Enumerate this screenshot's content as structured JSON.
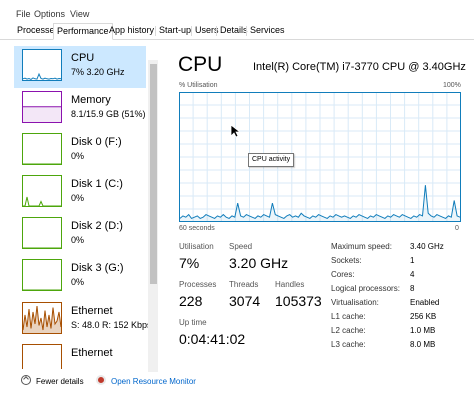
{
  "menu": [
    "File",
    "Options",
    "View"
  ],
  "tabs": [
    "Processes",
    "Performance",
    "App history",
    "Start-up",
    "Users",
    "Details",
    "Services"
  ],
  "active_tab": "Performance",
  "sidebar": {
    "items": [
      {
        "name": "CPU",
        "value": "7% 3.20 GHz",
        "color": "#117dbb"
      },
      {
        "name": "Memory",
        "value": "8.1/15.9 GB (51%)",
        "color": "#8b12ae"
      },
      {
        "name": "Disk 0 (F:)",
        "value": "0%",
        "color": "#4da60c"
      },
      {
        "name": "Disk 1 (C:)",
        "value": "0%",
        "color": "#4da60c"
      },
      {
        "name": "Disk 2 (D:)",
        "value": "0%",
        "color": "#4da60c"
      },
      {
        "name": "Disk 3 (G:)",
        "value": "0%",
        "color": "#4da60c"
      },
      {
        "name": "Ethernet",
        "value": "S: 48.0 R: 152 Kbps",
        "color": "#a74f01"
      },
      {
        "name": "Ethernet",
        "value": "",
        "color": "#a74f01"
      }
    ]
  },
  "main": {
    "title": "CPU",
    "model": "Intel(R) Core(TM) i7-3770 CPU @ 3.40GHz",
    "util_label": "% Utilisation",
    "util_max": "100%",
    "time_left": "60 seconds",
    "time_right": "0",
    "tooltip": "CPU activity",
    "graph_color": "#117dbb",
    "graph_grid_color": "#d9eaf7"
  },
  "stats": {
    "utilisation_label": "Utilisation",
    "utilisation": "7%",
    "speed_label": "Speed",
    "speed": "3.20 GHz",
    "processes_label": "Processes",
    "processes": "228",
    "threads_label": "Threads",
    "threads": "3074",
    "handles_label": "Handles",
    "handles": "105373",
    "uptime_label": "Up time",
    "uptime": "0:04:41:02"
  },
  "specs": [
    {
      "label": "Maximum speed:",
      "value": "3.40 GHz"
    },
    {
      "label": "Sockets:",
      "value": "1"
    },
    {
      "label": "Cores:",
      "value": "4"
    },
    {
      "label": "Logical processors:",
      "value": "8"
    },
    {
      "label": "Virtualisation:",
      "value": "Enabled"
    },
    {
      "label": "L1 cache:",
      "value": "256 KB"
    },
    {
      "label": "L2 cache:",
      "value": "1.0 MB"
    },
    {
      "label": "L3 cache:",
      "value": "8.0 MB"
    }
  ],
  "footer": {
    "fewer_details": "Fewer details",
    "open_monitor": "Open Resource Monitor"
  },
  "cpu_history": [
    2,
    4,
    3,
    5,
    2,
    3,
    4,
    2,
    3,
    5,
    4,
    3,
    2,
    4,
    3,
    5,
    3,
    2,
    4,
    3,
    14,
    4,
    3,
    5,
    4,
    3,
    2,
    4,
    3,
    5,
    4,
    3,
    14,
    5,
    4,
    3,
    2,
    4,
    5,
    3,
    4,
    3,
    6,
    4,
    3,
    2,
    4,
    3,
    5,
    4,
    3,
    2,
    4,
    3,
    5,
    4,
    3,
    4,
    3,
    2,
    4,
    3,
    5,
    4,
    3,
    2,
    4,
    3,
    5,
    4,
    3,
    2,
    4,
    3,
    5,
    4,
    3,
    5,
    4,
    3,
    2,
    4,
    3,
    5,
    4,
    28,
    6,
    4,
    3,
    5,
    4,
    3,
    2,
    4,
    3,
    16,
    4,
    3
  ]
}
